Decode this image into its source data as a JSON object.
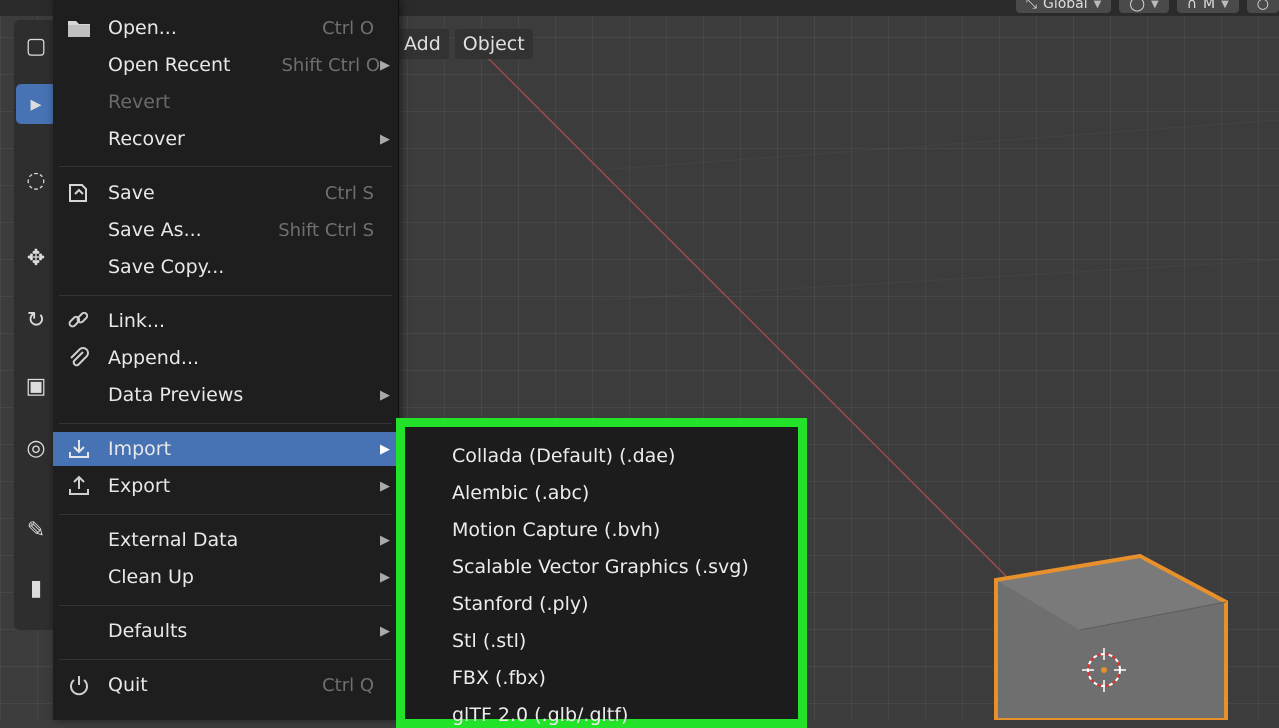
{
  "header": {
    "transform_orientation": "Global",
    "snap_label": "",
    "proportional_label": "M"
  },
  "viewport_menu": {
    "add": "Add",
    "object": "Object"
  },
  "toolbar": {
    "tools": [
      "select-box-icon",
      "cursor-icon",
      "move-icon",
      "rotate-icon",
      "scale-icon",
      "transform-icon",
      "annotate-icon",
      "measure-icon"
    ]
  },
  "file_menu": {
    "items": [
      {
        "label": "Open...",
        "shortcut": "Ctrl O"
      },
      {
        "label": "Open Recent",
        "shortcut": "Shift Ctrl O"
      },
      {
        "label": "Revert",
        "shortcut": ""
      },
      {
        "label": "Recover",
        "shortcut": ""
      },
      {
        "label": "Save",
        "shortcut": "Ctrl S"
      },
      {
        "label": "Save As...",
        "shortcut": "Shift Ctrl S"
      },
      {
        "label": "Save Copy...",
        "shortcut": ""
      },
      {
        "label": "Link...",
        "shortcut": ""
      },
      {
        "label": "Append...",
        "shortcut": ""
      },
      {
        "label": "Data Previews",
        "shortcut": ""
      },
      {
        "label": "Import",
        "shortcut": ""
      },
      {
        "label": "Export",
        "shortcut": ""
      },
      {
        "label": "External Data",
        "shortcut": ""
      },
      {
        "label": "Clean Up",
        "shortcut": ""
      },
      {
        "label": "Defaults",
        "shortcut": ""
      },
      {
        "label": "Quit",
        "shortcut": "Ctrl Q"
      }
    ]
  },
  "import_menu": {
    "items": [
      "Collada (Default) (.dae)",
      "Alembic (.abc)",
      "Motion Capture (.bvh)",
      "Scalable Vector Graphics (.svg)",
      "Stanford (.ply)",
      "Stl (.stl)",
      "FBX (.fbx)",
      "glTF 2.0 (.glb/.gltf)"
    ]
  },
  "colors": {
    "highlight": "#4772b3",
    "annotation_box": "#22e32a",
    "selection_outline": "#e8902b"
  }
}
